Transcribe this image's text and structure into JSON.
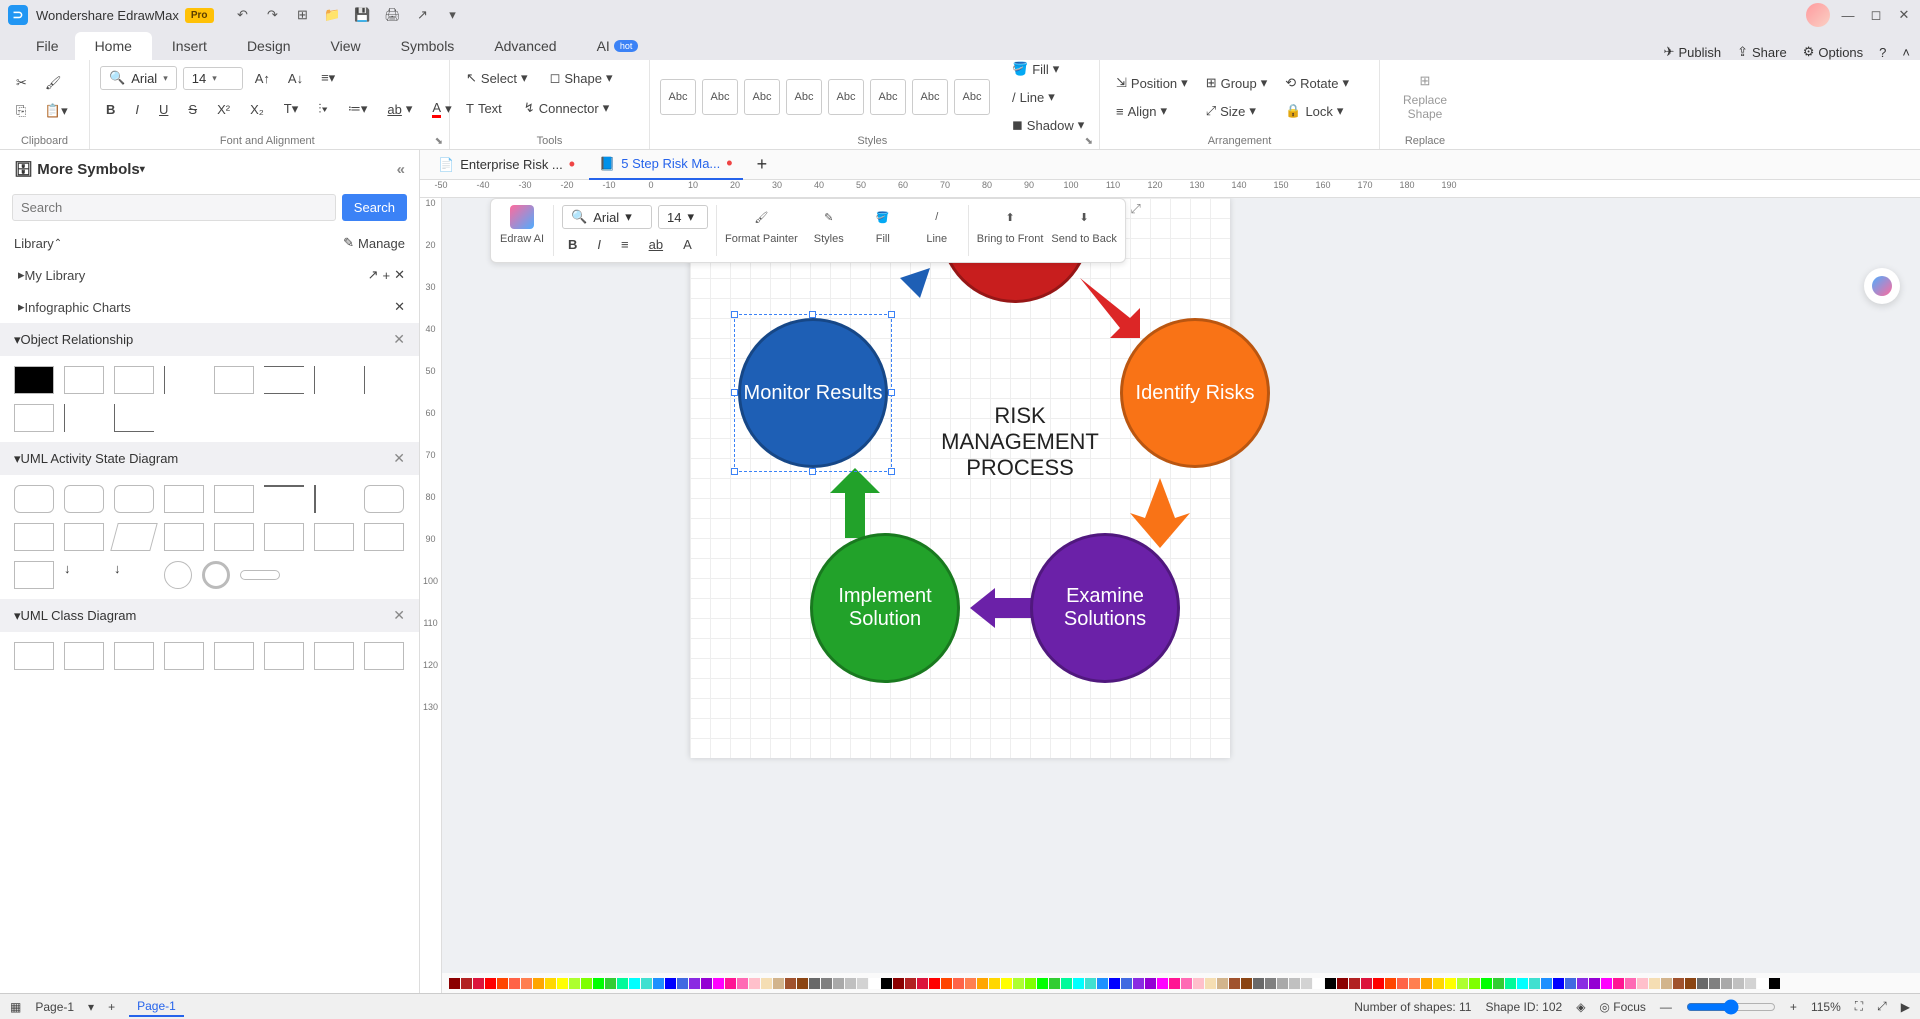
{
  "titlebar": {
    "app_name": "Wondershare EdrawMax",
    "pro": "Pro"
  },
  "menus": {
    "file": "File",
    "home": "Home",
    "insert": "Insert",
    "design": "Design",
    "view": "View",
    "symbols": "Symbols",
    "advanced": "Advanced",
    "ai": "AI",
    "hot": "hot"
  },
  "menuright": {
    "publish": "Publish",
    "share": "Share",
    "options": "Options"
  },
  "ribbon": {
    "clipboard": "Clipboard",
    "font_alignment": "Font and Alignment",
    "tools": "Tools",
    "styles": "Styles",
    "arrangement": "Arrangement",
    "replace": "Replace",
    "font_name": "Arial",
    "font_size": "14",
    "select": "Select",
    "shape": "Shape",
    "text": "Text",
    "connector": "Connector",
    "fill": "Fill",
    "line": "Line",
    "shadow": "Shadow",
    "position": "Position",
    "align": "Align",
    "group": "Group",
    "size": "Size",
    "rotate": "Rotate",
    "lock": "Lock",
    "replace_shape": "Replace\nShape",
    "abc": "Abc"
  },
  "symbols": {
    "more_symbols": "More Symbols",
    "search_placeholder": "Search",
    "search_btn": "Search",
    "library": "Library",
    "manage": "Manage",
    "my_library": "My Library",
    "infographic_charts": "Infographic Charts",
    "object_relationship": "Object Relationship",
    "uml_activity": "UML Activity State Diagram",
    "uml_class": "UML Class Diagram"
  },
  "doc_tabs": {
    "tab1": "Enterprise Risk ...",
    "tab2": "5 Step Risk Ma..."
  },
  "diagram": {
    "center": "RISK MANAGEMENT PROCESS",
    "monitor": "Monitor Results",
    "identify": "Identify Risks",
    "examine": "Examine Solutions",
    "implement": "Implement Solution"
  },
  "floating": {
    "edraw_ai": "Edraw AI",
    "format_painter": "Format Painter",
    "styles": "Styles",
    "fill": "Fill",
    "line": "Line",
    "bring_front": "Bring to Front",
    "send_back": "Send to Back",
    "font": "Arial",
    "size": "14"
  },
  "status": {
    "page_label": "Page-1",
    "page_tab": "Page-1",
    "num_shapes": "Number of shapes: 11",
    "shape_id": "Shape ID: 102",
    "focus": "Focus",
    "zoom": "115%"
  },
  "colors": [
    "#8b0000",
    "#b22222",
    "#dc143c",
    "#ff0000",
    "#ff4500",
    "#ff6347",
    "#ff7f50",
    "#ffa500",
    "#ffd700",
    "#ffff00",
    "#adff2f",
    "#7fff00",
    "#00ff00",
    "#32cd32",
    "#00fa9a",
    "#00ffff",
    "#40e0d0",
    "#1e90ff",
    "#0000ff",
    "#4169e1",
    "#8a2be2",
    "#9400d3",
    "#ff00ff",
    "#ff1493",
    "#ff69b4",
    "#ffc0cb",
    "#f5deb3",
    "#d2b48c",
    "#a0522d",
    "#8b4513",
    "#696969",
    "#808080",
    "#a9a9a9",
    "#c0c0c0",
    "#d3d3d3",
    "#ffffff",
    "#000000"
  ]
}
